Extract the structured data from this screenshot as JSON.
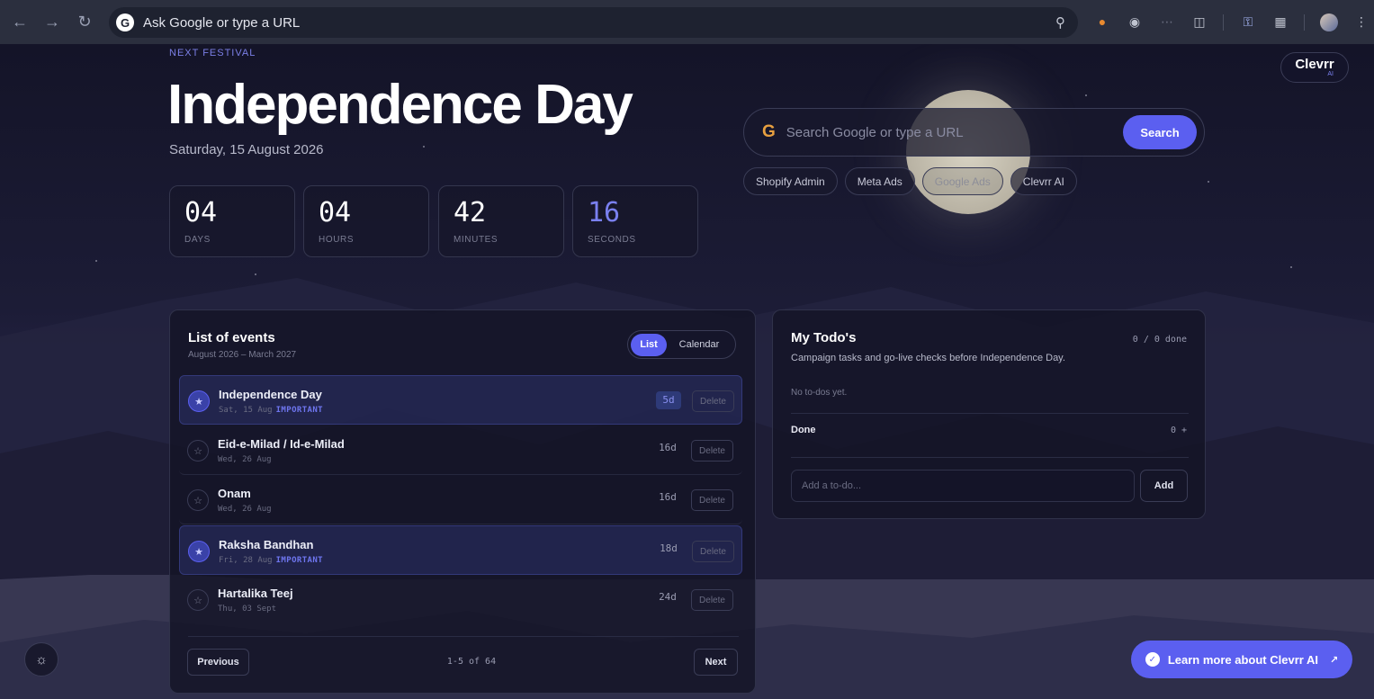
{
  "browser": {
    "address_text": "Ask Google or type a URL"
  },
  "hero": {
    "label": "NEXT FESTIVAL",
    "title": "Independence Day",
    "date": "Saturday, 15 August 2026",
    "countdown": [
      {
        "value": "04",
        "label": "DAYS"
      },
      {
        "value": "04",
        "label": "HOURS"
      },
      {
        "value": "42",
        "label": "MINUTES"
      },
      {
        "value": "16",
        "label": "SECONDS"
      }
    ]
  },
  "logo": {
    "text": "Clevrr",
    "sub": "AI"
  },
  "search": {
    "placeholder": "Search Google or type a URL",
    "button": "Search",
    "quicklinks": [
      "Shopify Admin",
      "Meta Ads",
      "Google Ads",
      "Clevrr AI"
    ]
  },
  "events": {
    "title": "List of events",
    "subtitle": "August 2026 – March 2027",
    "toggle": {
      "list": "List",
      "calendar": "Calendar"
    },
    "rows": [
      {
        "name": "Independence Day",
        "date": "Sat, 15 Aug",
        "tag": "IMPORTANT",
        "days": "5d",
        "delete": "Delete"
      },
      {
        "name": "Eid-e-Milad / Id-e-Milad",
        "date": "Wed, 26 Aug",
        "tag": "",
        "days": "16d",
        "delete": "Delete"
      },
      {
        "name": "Onam",
        "date": "Wed, 26 Aug",
        "tag": "",
        "days": "16d",
        "delete": "Delete"
      },
      {
        "name": "Raksha Bandhan",
        "date": "Fri, 28 Aug",
        "tag": "IMPORTANT",
        "days": "18d",
        "delete": "Delete"
      },
      {
        "name": "Hartalika Teej",
        "date": "Thu, 03 Sept",
        "tag": "",
        "days": "24d",
        "delete": "Delete"
      }
    ],
    "previous": "Previous",
    "next": "Next",
    "pagination": "1-5 of 64"
  },
  "todos": {
    "title": "My Todo's",
    "count": "0 / 0 done",
    "subtitle": "Campaign tasks and go-live checks before Independence Day.",
    "empty": "No to-dos yet.",
    "done_label": "Done",
    "done_count": "0 +",
    "input_placeholder": "Add a to-do...",
    "add": "Add"
  },
  "cta": {
    "label": "Learn more about Clevrr AI",
    "arrow": "↗"
  },
  "colors": {
    "accent": "#5b5ff0",
    "background": "#161629"
  }
}
